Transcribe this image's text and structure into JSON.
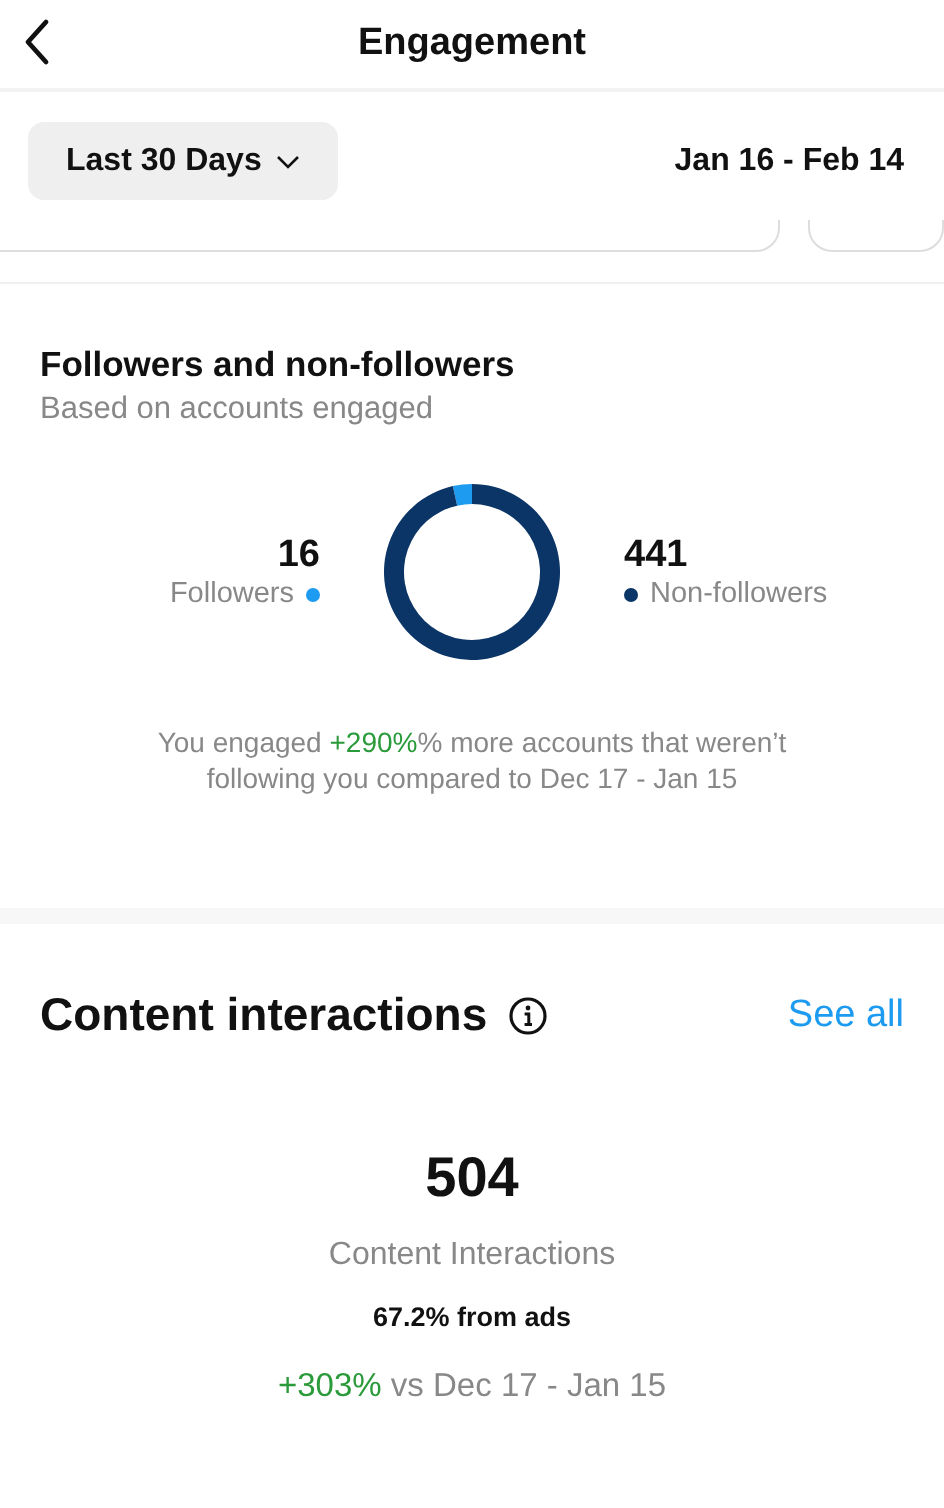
{
  "header": {
    "title": "Engagement"
  },
  "period": {
    "label": "Last 30 Days",
    "range": "Jan 16 - Feb 14"
  },
  "followers_section": {
    "title": "Followers and non-followers",
    "subtitle": "Based on accounts engaged",
    "legend": [
      {
        "value": "16",
        "color": "#1d9bf0"
      },
      {
        "value": "441",
        "color": "#0b3566"
      }
    ],
    "chart_data": {
      "type": "donut",
      "categories": [
        "Followers",
        "Non-followers"
      ],
      "values": [
        3.5,
        96.5
      ]
    },
    "note": {
      "before": "You engaged ",
      "highlight": "+290%",
      "after": "% more accounts that weren’t following you compared to Dec 17 - Jan 15"
    }
  },
  "content_section": {
    "title": "Content interactions",
    "link": "See all",
    "total": "504",
    "total_label": "Content Interactions",
    "ads_share": "67.2% from ads",
    "change": "+303%",
    "change_label": "vs Dec 17 - Jan 15"
  }
}
